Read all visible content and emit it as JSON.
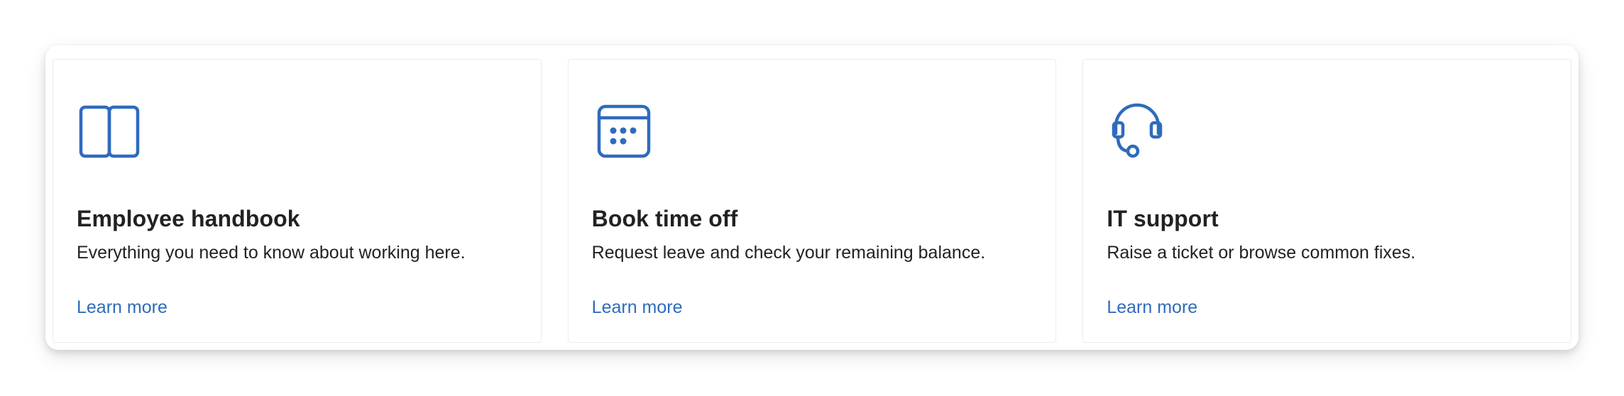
{
  "theme": {
    "accent": "#2f6bbd",
    "text": "#222222",
    "card_border": "#ececec"
  },
  "cards": [
    {
      "icon": "book-icon",
      "title": "Employee handbook",
      "description": "Everything you need to know about working here.",
      "link_label": "Learn more"
    },
    {
      "icon": "calendar-icon",
      "title": "Book time off",
      "description": "Request leave and check your remaining balance.",
      "link_label": "Learn more"
    },
    {
      "icon": "headset-icon",
      "title": "IT support",
      "description": "Raise a ticket or browse common fixes.",
      "link_label": "Learn more"
    }
  ]
}
